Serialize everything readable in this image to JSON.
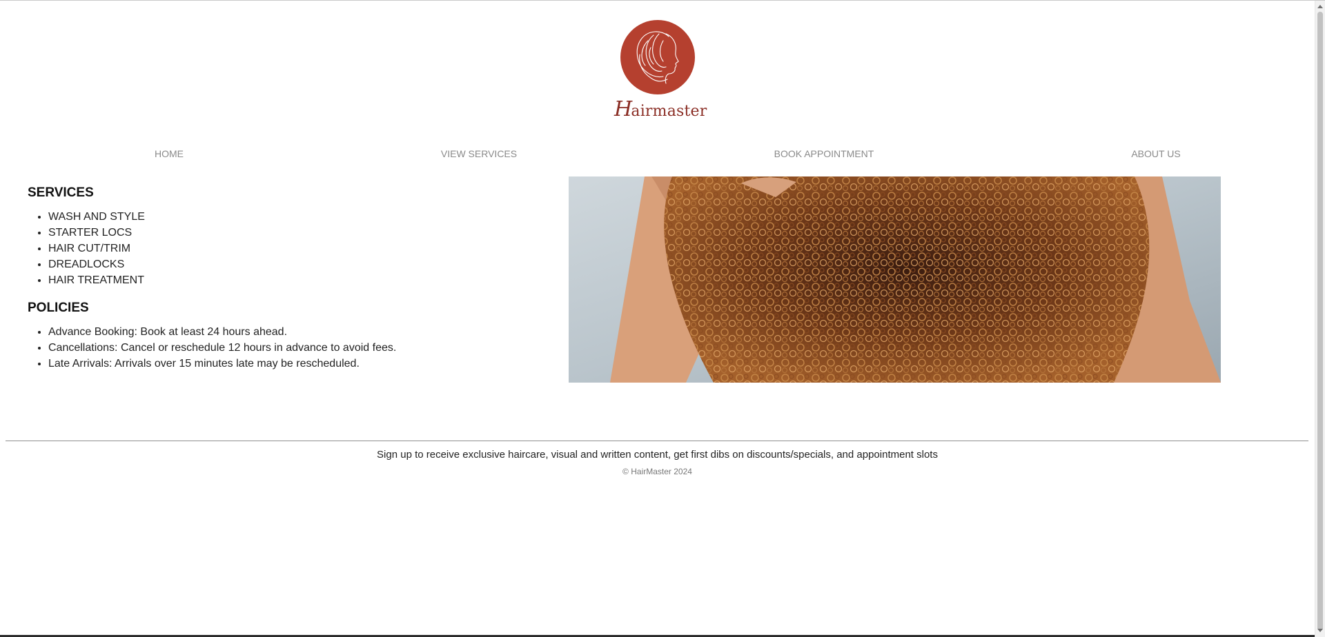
{
  "brand": {
    "wordmark_initial": "H",
    "wordmark_rest": "airmaster",
    "accent_color": "#b5402f"
  },
  "nav": {
    "items": [
      {
        "label": "HOME"
      },
      {
        "label": "VIEW SERVICES"
      },
      {
        "label": "BOOK APPOINTMENT"
      },
      {
        "label": "ABOUT US"
      }
    ]
  },
  "services": {
    "heading": "SERVICES",
    "items": [
      "WASH AND STYLE",
      "STARTER LOCS",
      "HAIR CUT/TRIM",
      "DREADLOCKS",
      "HAIR TREATMENT"
    ]
  },
  "policies": {
    "heading": "POLICIES",
    "items": [
      "Advance Booking: Book at least 24 hours ahead.",
      "Cancellations: Cancel or reschedule 12 hours in advance to avoid fees.",
      "Late Arrivals: Arrivals over 15 minutes late may be rescheduled."
    ]
  },
  "hero": {
    "icon": "curly-hair-photo"
  },
  "footer": {
    "signup_text": "Sign up to receive exclusive haircare, visual and written content, get first dibs on discounts/specials, and appointment slots",
    "copyright": "© HairMaster 2024"
  }
}
